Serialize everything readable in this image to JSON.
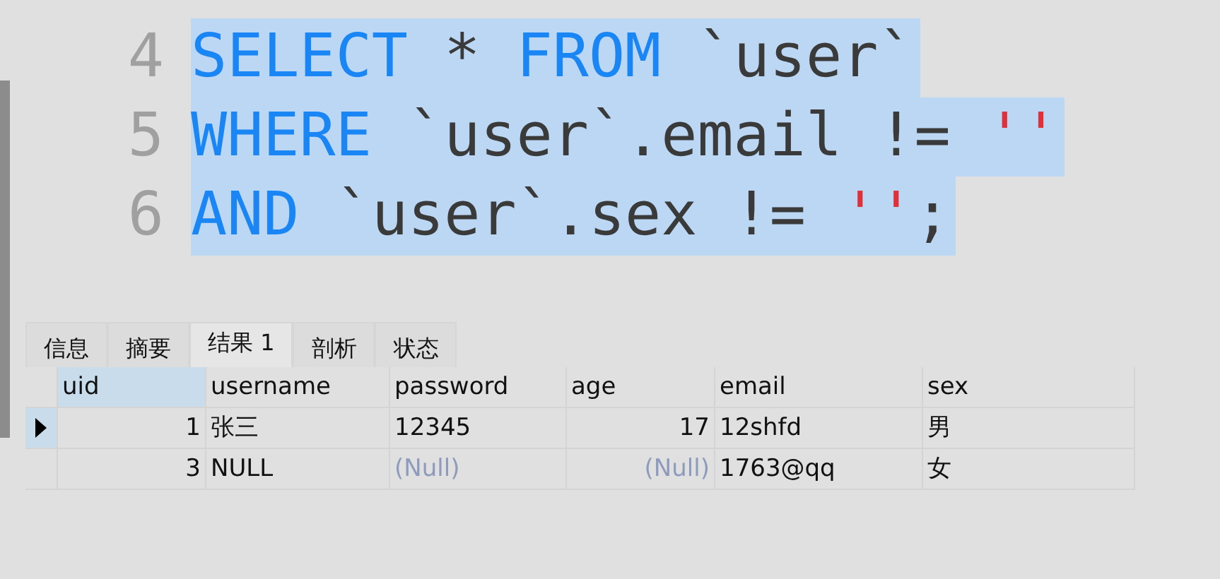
{
  "editor": {
    "lines": [
      {
        "number": "4",
        "selected": true,
        "tokens": [
          {
            "kind": "keyword",
            "text": "SELECT"
          },
          {
            "kind": "plain",
            "text": " * "
          },
          {
            "kind": "keyword",
            "text": "FROM"
          },
          {
            "kind": "plain",
            "text": " `user`"
          }
        ]
      },
      {
        "number": "5",
        "selected": true,
        "tokens": [
          {
            "kind": "keyword",
            "text": "WHERE"
          },
          {
            "kind": "plain",
            "text": " `user`.email != "
          },
          {
            "kind": "string",
            "text": "''"
          }
        ]
      },
      {
        "number": "6",
        "selected": true,
        "tokens": [
          {
            "kind": "keyword",
            "text": "AND"
          },
          {
            "kind": "plain",
            "text": " `user`.sex != "
          },
          {
            "kind": "string",
            "text": "''"
          },
          {
            "kind": "plain",
            "text": ";"
          }
        ]
      }
    ]
  },
  "tabs": [
    {
      "label": "信息",
      "selected": false
    },
    {
      "label": "摘要",
      "selected": false
    },
    {
      "label": "结果 1",
      "selected": true
    },
    {
      "label": "剖析",
      "selected": false
    },
    {
      "label": "状态",
      "selected": false
    }
  ],
  "table": {
    "columns": [
      {
        "label": "uid",
        "kind": "number",
        "selected": true
      },
      {
        "label": "username",
        "kind": "text",
        "selected": false
      },
      {
        "label": "password",
        "kind": "text",
        "selected": false
      },
      {
        "label": "age",
        "kind": "number",
        "selected": false
      },
      {
        "label": "email",
        "kind": "text",
        "selected": false
      },
      {
        "label": "sex",
        "kind": "text",
        "selected": false
      }
    ],
    "rows": [
      {
        "current": true,
        "cells": [
          {
            "kind": "value",
            "text": "1"
          },
          {
            "kind": "value",
            "text": "张三"
          },
          {
            "kind": "value",
            "text": "12345"
          },
          {
            "kind": "value",
            "text": "17"
          },
          {
            "kind": "value",
            "text": "12shfd"
          },
          {
            "kind": "value",
            "text": "男"
          }
        ]
      },
      {
        "current": false,
        "cells": [
          {
            "kind": "value",
            "text": "3"
          },
          {
            "kind": "value",
            "text": "NULL"
          },
          {
            "kind": "null",
            "text": "(Null)"
          },
          {
            "kind": "null",
            "text": "(Null)"
          },
          {
            "kind": "value",
            "text": "1763@qq"
          },
          {
            "kind": "value",
            "text": "女"
          }
        ]
      }
    ]
  }
}
